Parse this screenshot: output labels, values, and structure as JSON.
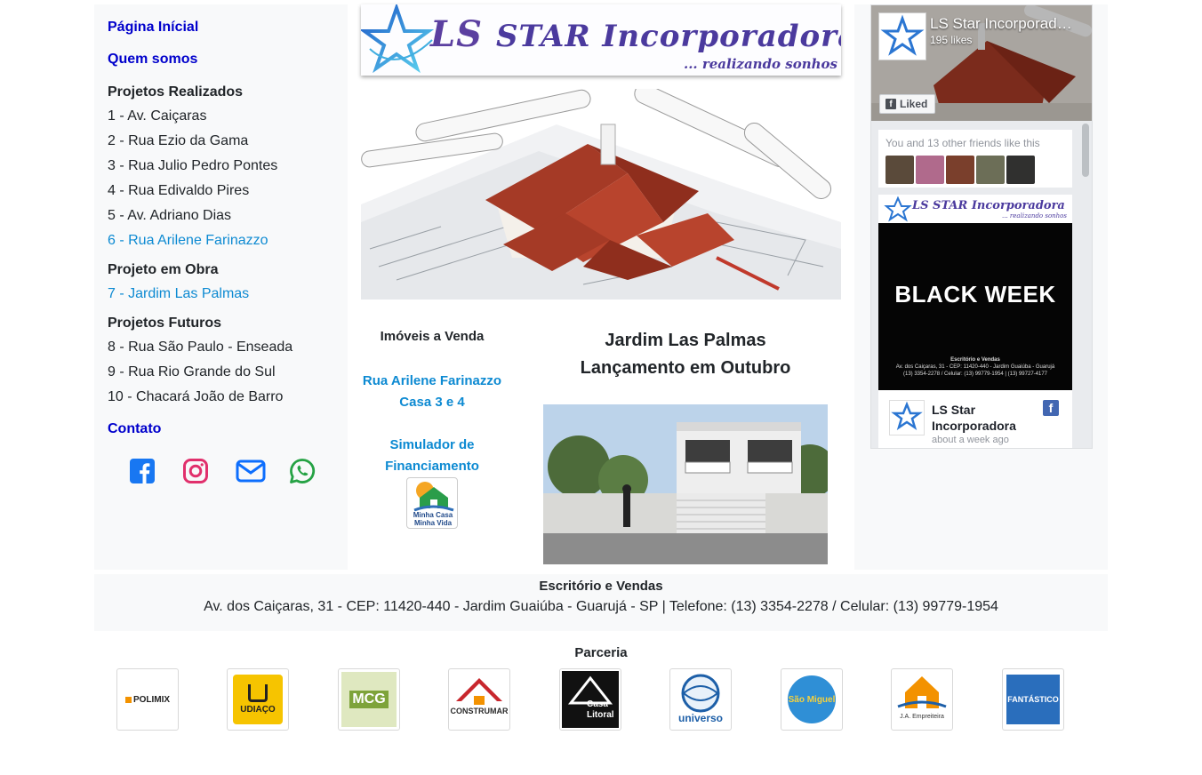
{
  "sidebar": {
    "home": "Página Inícial",
    "about": "Quem somos",
    "realized_title": "Projetos Realizados",
    "realized": [
      "1 - Av. Caiçaras",
      "2 - Rua Ezio da Gama",
      "3 - Rua Julio Pedro Pontes",
      "4 - Rua Edivaldo Pires",
      "5 - Av. Adriano Dias",
      "6 - Rua Arilene Farinazzo"
    ],
    "in_progress_title": "Projeto em Obra",
    "in_progress": [
      "7 - Jardim Las Palmas"
    ],
    "future_title": "Projetos Futuros",
    "future": [
      "8 - Rua São Paulo - Enseada",
      "9 - Rua Rio Grande do Sul",
      "10 - Chacará João de Barro"
    ],
    "contact": "Contato",
    "social_icons": [
      "facebook-icon",
      "instagram-icon",
      "mail-icon",
      "whatsapp-icon"
    ]
  },
  "banner": {
    "logo_ls": "LS",
    "logo_text": "STAR Incorporadora",
    "slogan": "... realizando sonhos"
  },
  "imoveis": {
    "title": "Imóveis a Venda",
    "link1_line1": "Rua Arilene Farinazzo",
    "link1_line2": "Casa 3 e 4",
    "link2_line1": "Simulador de",
    "link2_line2": "Financiamento",
    "mcmv_line1": "Minha Casa",
    "mcmv_line2": "Minha Vida"
  },
  "featured": {
    "line1": "Jardim Las Palmas",
    "line2": "Lançamento em Outubro"
  },
  "facebook": {
    "page_name": "LS Star Incorporadora",
    "likes": "195 likes",
    "liked_button": "Liked",
    "friends_text": "You and 13 other friends like this",
    "post_logo": "LS STAR Incorporadora",
    "post_slogan": "... realizando sonhos",
    "post_title": "BLACK WEEK",
    "post_small1": "Escritório e Vendas",
    "post_small2": "Av. dos Caiçaras, 31 - CEP: 11420-440 - Jardim Guaiúba - Guarujá",
    "post_small3": "(13) 3354-2278 / Celular: (13) 99779-1954 | (13) 99727-4177",
    "post_author": "LS Star Incorporadora",
    "post_time": "about a week ago",
    "fb_glyph": "f"
  },
  "office": {
    "title": "Escritório e Vendas",
    "address": "Av. dos Caiçaras, 31 - CEP: 11420-440 - Jardim Guaiúba - Guarujá - SP | Telefone: (13) 3354-2278 / Celular: (13) 99779-1954"
  },
  "partners": {
    "title": "Parceria",
    "items": [
      "POLIMIX",
      "UDIAÇO",
      "MCG",
      "CONSTRUMAR",
      "Casa Litoral",
      "universo",
      "São Miguel",
      "J.A. Empreiteira",
      "FANTÁSTICO"
    ]
  }
}
